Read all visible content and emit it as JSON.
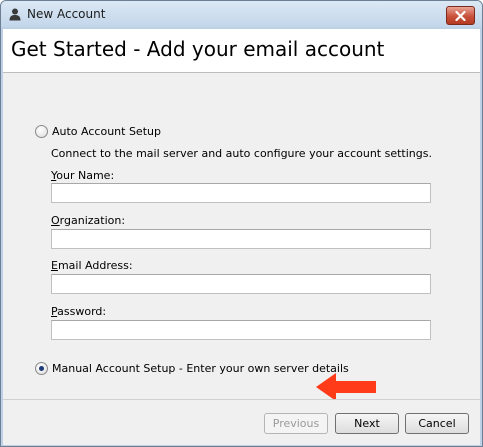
{
  "window": {
    "title": "New Account",
    "close_icon": "close-icon"
  },
  "header": {
    "title": "Get Started - Add your email account"
  },
  "auto_setup": {
    "label": "Auto Account Setup",
    "selected": false,
    "description": "Connect to the mail server and auto configure your account settings.",
    "fields": {
      "name": {
        "label_underlined": "Y",
        "label_rest": "our Name:",
        "value": ""
      },
      "organization": {
        "label_underlined": "O",
        "label_rest": "rganization:",
        "value": ""
      },
      "email": {
        "label_underlined": "E",
        "label_rest": "mail Address:",
        "value": ""
      },
      "password": {
        "label_underlined": "P",
        "label_rest": "assword:",
        "value": ""
      }
    }
  },
  "manual_setup": {
    "label": "Manual Account Setup - Enter your own server details",
    "selected": true
  },
  "annotation": {
    "arrow_color": "#ff3b1a",
    "arrow_icon": "left-arrow-icon"
  },
  "footer": {
    "previous_label": "Previous",
    "previous_disabled": true,
    "next_label": "Next",
    "cancel_label": "Cancel"
  }
}
